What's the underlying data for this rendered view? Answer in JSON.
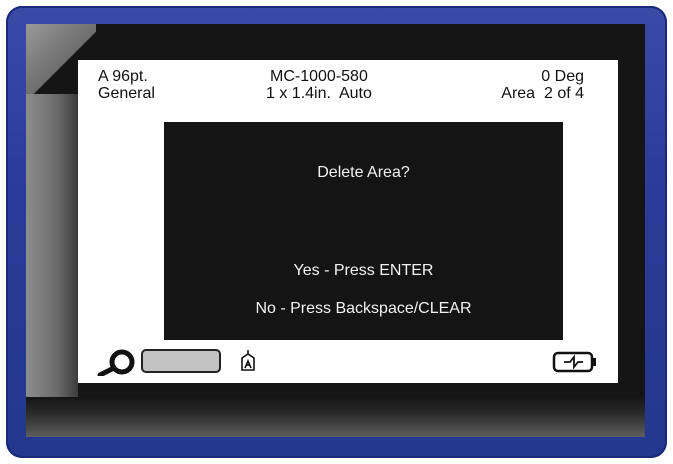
{
  "header": {
    "font": "A 96pt.",
    "category": "General",
    "part": "MC-1000-580",
    "size": "1 x 1.4in.  Auto",
    "rotation": "0 Deg",
    "area": "Area  2 of 4"
  },
  "dialog": {
    "title": "Delete Area?",
    "yes": "Yes - Press ENTER",
    "no": "No - Press Backspace/CLEAR"
  },
  "icons": [
    "tape-roll-icon",
    "ribbon-cartridge-icon",
    "print-head-icon",
    "battery-charging-icon"
  ],
  "colors": {
    "frame": "#2b3c98",
    "bezel": "#151515",
    "screen": "#ffffff",
    "dialog": "#141414"
  }
}
